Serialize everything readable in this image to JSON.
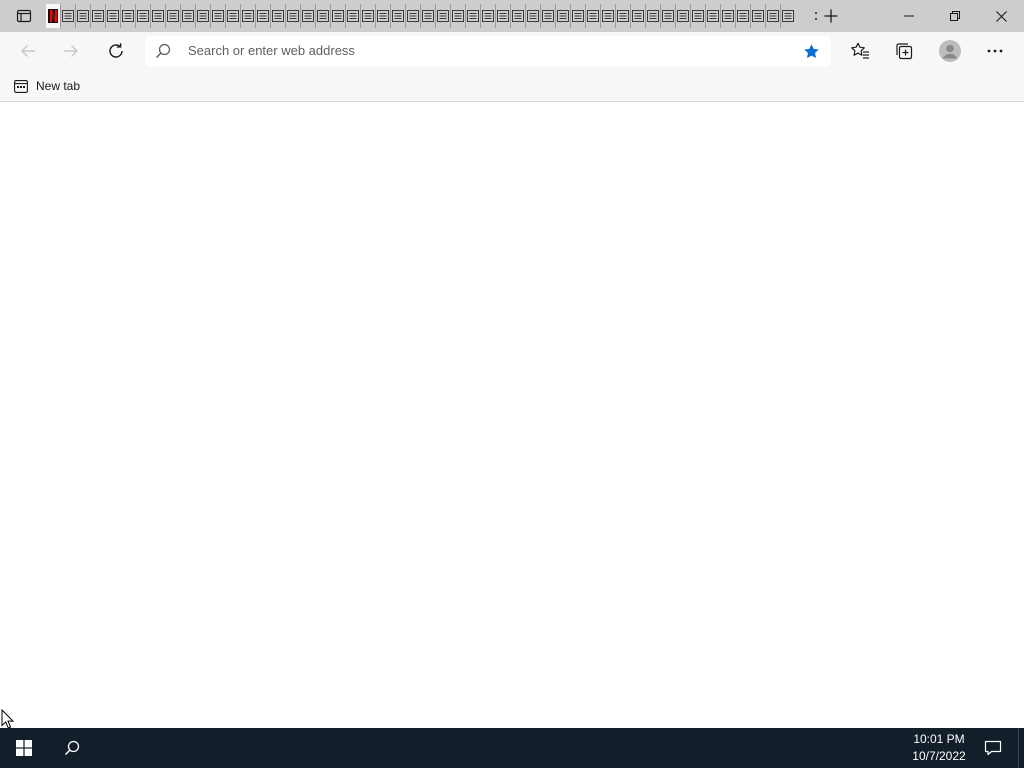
{
  "browser": {
    "tab_count": 50,
    "active_tab_icon": "netflix-icon",
    "tab_icon": "generic-page-icon",
    "accent_color": "#0a6ed1"
  },
  "toolbar": {
    "omnibox_placeholder": "Search or enter web address",
    "favorite_active": true
  },
  "favorites_bar": {
    "items": [
      {
        "label": "New tab",
        "icon": "new-tab-favorite-icon"
      }
    ]
  },
  "taskbar": {
    "time": "10:01 PM",
    "date": "10/7/2022",
    "background": "#121e29"
  }
}
